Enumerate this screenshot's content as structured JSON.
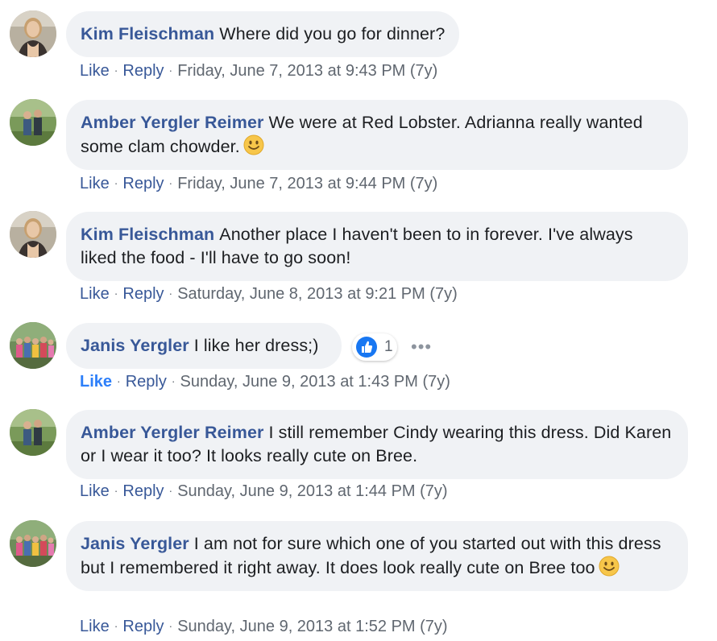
{
  "comments": [
    {
      "author": "Kim Fleischman",
      "text": "Where did you go for dinner?",
      "like_label": "Like",
      "reply_label": "Reply",
      "timestamp": "Friday, June 7, 2013 at 9:43 PM (7y)",
      "avatar_icon": "woman-portrait-avatar"
    },
    {
      "author": "Amber Yergler Reimer",
      "text": "We were at Red Lobster. Adrianna really wanted some clam chowder.",
      "emoji": "smiley-emoji",
      "like_label": "Like",
      "reply_label": "Reply",
      "timestamp": "Friday, June 7, 2013 at 9:44 PM (7y)",
      "avatar_icon": "outdoor-couple-avatar"
    },
    {
      "author": "Kim Fleischman",
      "text": "Another place I haven't been to in forever. I've always liked the food - I'll have to go soon!",
      "like_label": "Like",
      "reply_label": "Reply",
      "timestamp": "Saturday, June 8, 2013 at 9:21 PM (7y)",
      "avatar_icon": "woman-portrait-avatar"
    },
    {
      "author": "Janis Yergler",
      "text": "I like her dress;)",
      "reaction_count": "1",
      "reaction_icon": "thumbs-up-reaction-icon",
      "like_label": "Like",
      "like_active": true,
      "reply_label": "Reply",
      "timestamp": "Sunday, June 9, 2013 at 1:43 PM (7y)",
      "avatar_icon": "family-group-avatar"
    },
    {
      "author": "Amber Yergler Reimer",
      "text": "I still remember Cindy wearing this dress. Did Karen or I wear it too? It looks really cute on Bree.",
      "like_label": "Like",
      "reply_label": "Reply",
      "timestamp": "Sunday, June 9, 2013 at 1:44 PM (7y)",
      "avatar_icon": "outdoor-couple-avatar"
    },
    {
      "author": "Janis Yergler",
      "text": "I am not for sure which one of you started out with this dress but I remembered it right away. It does look really cute on Bree too",
      "emoji": "smiley-emoji",
      "like_label": "Like",
      "reply_label": "Reply",
      "timestamp": "Sunday, June 9, 2013 at 1:52 PM (7y)",
      "avatar_icon": "family-group-avatar"
    }
  ],
  "colors": {
    "author": "#385898",
    "bubble": "#f0f2f5",
    "meta": "#606770",
    "like_active": "#2d7ff9"
  }
}
